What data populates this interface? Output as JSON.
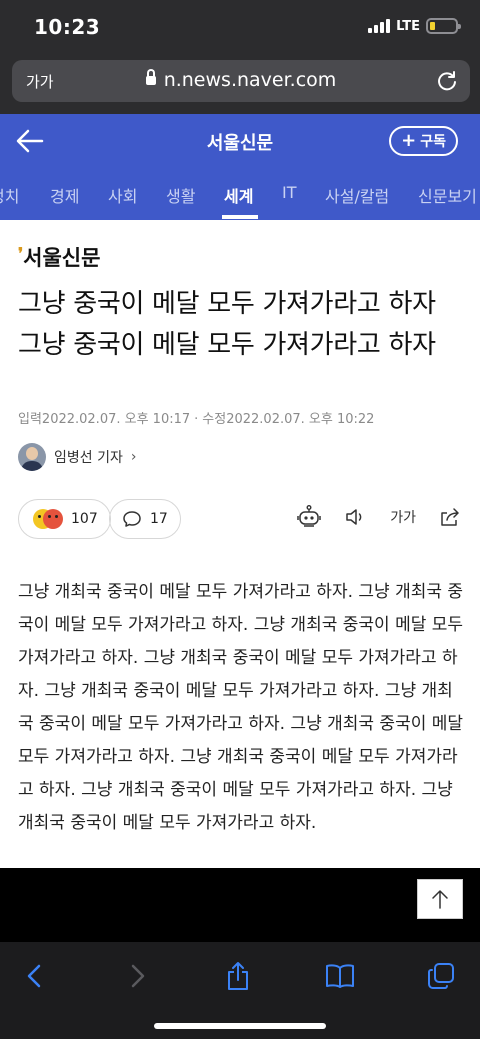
{
  "status": {
    "time": "10:23",
    "network": "LTE"
  },
  "browser": {
    "text_size_label": "가가",
    "url": "n.news.naver.com"
  },
  "header": {
    "title": "서울신문",
    "subscribe_label": "구독"
  },
  "tabs": [
    {
      "label": "정치",
      "active": false
    },
    {
      "label": "경제",
      "active": false
    },
    {
      "label": "사회",
      "active": false
    },
    {
      "label": "생활",
      "active": false
    },
    {
      "label": "세계",
      "active": true
    },
    {
      "label": "IT",
      "active": false
    },
    {
      "label": "사설/칼럼",
      "active": false
    },
    {
      "label": "신문보기",
      "active": false
    }
  ],
  "article": {
    "press_logo": "서울신문",
    "headline": "그냥 중국이 메달 모두 가져가라고 하자 그냥 중국이 메달 모두 가져가라고 하자",
    "input_label": "입력",
    "input_date": "2022.02.07. 오후 10:17",
    "modified_label": "수정",
    "modified_date": "2022.02.07. 오후 10:22",
    "reporter": "임병선 기자",
    "reactions_count": "107",
    "comments_count": "17",
    "text_size_label": "가가",
    "body": "그냥 개최국 중국이 메달 모두 가져가라고 하자. 그냥 개최국 중국이 메달 모두 가져가라고 하자. 그냥 개최국 중국이 메달 모두 가져가라고 하자. 그냥 개최국 중국이 메달 모두 가져가라고 하자. 그냥 개최국 중국이 메달 모두 가져가라고 하자. 그냥 개최국 중국이 메달 모두 가져가라고 하자. 그냥 개최국 중국이 메달 모두 가져가라고 하자. 그냥 개최국 중국이 메달 모두 가져가라고 하자. 그냥 개최국 중국이 메달 모두 가져가라고 하자. 그냥 개최국 중국이 메달 모두 가져가라고 하자."
  },
  "colors": {
    "accent": "#3f59c9",
    "logo_mark": "#d99a1e",
    "toolbar_icon": "#3b82f6"
  },
  "icons": [
    "back-arrow-icon",
    "lock-icon",
    "reload-icon",
    "plus-icon",
    "robot-icon",
    "speaker-icon",
    "share-icon",
    "comment-icon",
    "scroll-top-icon",
    "safari-back-icon",
    "safari-forward-icon",
    "safari-share-icon",
    "bookmarks-icon",
    "tabs-icon"
  ]
}
